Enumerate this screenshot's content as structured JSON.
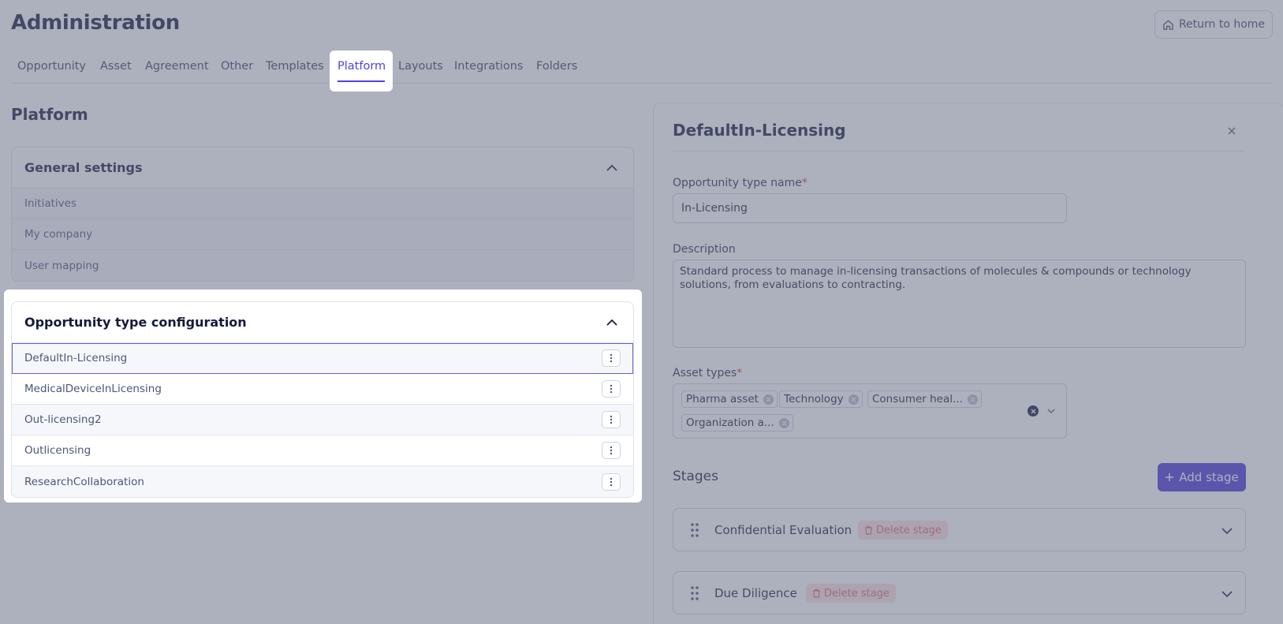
{
  "header": {
    "title": "Administration",
    "return_home_label": "Return to home"
  },
  "tabs": [
    {
      "label": "Opportunity"
    },
    {
      "label": "Asset"
    },
    {
      "label": "Agreement"
    },
    {
      "label": "Other"
    },
    {
      "label": "Templates"
    },
    {
      "label": "Platform",
      "active": true
    },
    {
      "label": "Layouts"
    },
    {
      "label": "Integrations"
    },
    {
      "label": "Folders"
    }
  ],
  "section_title": "Platform",
  "general_settings": {
    "title": "General settings",
    "items": [
      "Initiatives",
      "My company",
      "User mapping"
    ]
  },
  "opportunity_config": {
    "title": "Opportunity type configuration",
    "items": [
      "DefaultIn-Licensing",
      "MedicalDeviceInLicensing",
      "Out-licensing2",
      "Outlicensing",
      "ResearchCollaboration"
    ],
    "selected_index": 0
  },
  "panel": {
    "title": "DefaultIn-Licensing",
    "type_name_label": "Opportunity type name",
    "type_name_value": "In-Licensing",
    "description_label": "Description",
    "description_value": "Standard process to manage in-licensing transactions of molecules & compounds or technology solutions, from evaluations to contracting.",
    "asset_types_label": "Asset types",
    "asset_types": [
      "Pharma asset",
      "Technology",
      "Consumer heal...",
      "Organization a..."
    ],
    "required_mark": "*",
    "stages_label": "Stages",
    "add_stage_label": "Add stage",
    "stages": [
      {
        "name": "Confidential Evaluation",
        "delete_label": "Delete stage"
      },
      {
        "name": "Due Diligence",
        "delete_label": "Delete stage"
      }
    ]
  },
  "colors": {
    "accent": "#5140e2",
    "primary_button": "#4a35d8",
    "danger_soft": "#fbe3e3",
    "danger_text": "#e56b6b",
    "overlay": "#697086"
  }
}
